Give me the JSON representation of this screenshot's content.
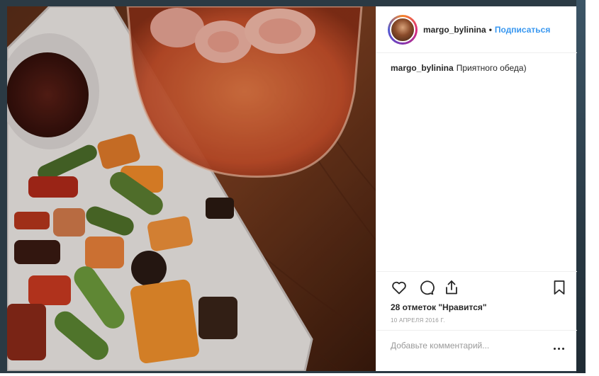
{
  "post": {
    "username": "margo_bylinina",
    "separator": "•",
    "follow_label": "Подписаться",
    "caption_user": "margo_bylinina",
    "caption_text": "Приятного обеда)",
    "likes_text": "28 отметок \"Нравится\"",
    "date_text": "10 АПРЕЛЯ 2016 Г."
  },
  "comment": {
    "placeholder": "Добавьте комментарий..."
  },
  "icons": {
    "like": "heart-icon",
    "comment": "comment-bubble-icon",
    "share": "share-icon",
    "save": "bookmark-icon",
    "more": "more-dots-icon"
  },
  "colors": {
    "follow_accent": "#3897f0",
    "text": "#262626",
    "muted": "#999999",
    "divider": "#efefef"
  }
}
